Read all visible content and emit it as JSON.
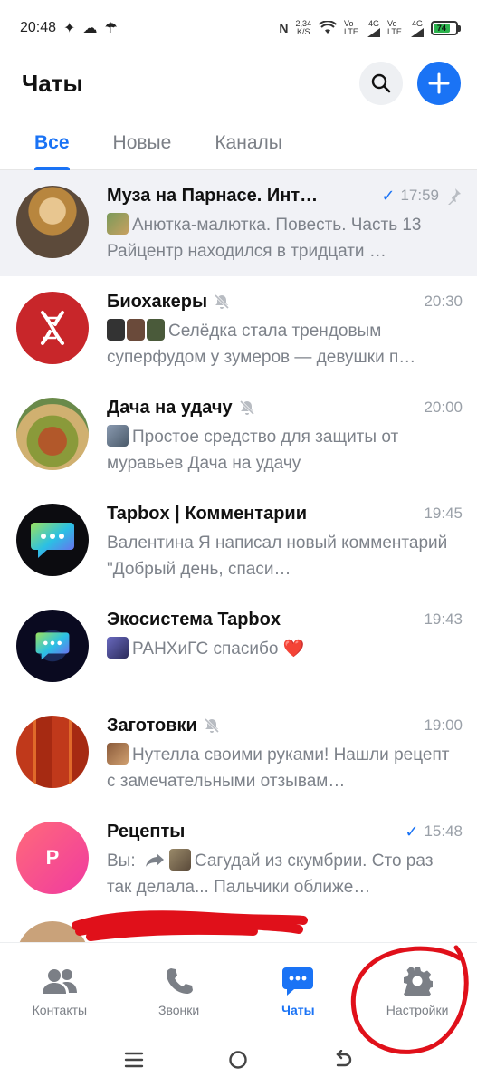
{
  "status_bar": {
    "time": "20:48",
    "net_speed_value": "2,34",
    "net_speed_unit": "K/S",
    "sim1": "Vo LTE",
    "sim1_net": "4G",
    "sim2": "Vo LTE",
    "sim2_net": "4G",
    "battery": "74"
  },
  "header": {
    "title": "Чаты",
    "search_icon": "search-icon",
    "add_icon": "plus-icon"
  },
  "tabs": [
    {
      "label": "Все",
      "active": true
    },
    {
      "label": "Новые",
      "active": false
    },
    {
      "label": "Каналы",
      "active": false
    }
  ],
  "chats": [
    {
      "name": "Муза на Парнасе. Инт…",
      "time": "17:59",
      "read": true,
      "pinned": true,
      "muted": false,
      "preview": "Анютка-малютка. Повесть. Часть 13 Райцентр находился в тридцати …",
      "prefix": ""
    },
    {
      "name": "Биохакеры",
      "time": "20:30",
      "read": false,
      "pinned": false,
      "muted": true,
      "preview": "Селёдка стала трендовым суперфудом у зумеров — девушки п…",
      "prefix": ""
    },
    {
      "name": "Дача на удачу",
      "time": "20:00",
      "read": false,
      "pinned": false,
      "muted": true,
      "preview": "Простое средство для защиты от муравьев Дача на удачу",
      "prefix": ""
    },
    {
      "name": "Tapbox | Комментарии",
      "time": "19:45",
      "read": false,
      "pinned": false,
      "muted": false,
      "preview": "Валентина Я написал новый комментарий \"Добрый день, спаси…",
      "prefix": ""
    },
    {
      "name": "Экосистема Tapbox",
      "time": "19:43",
      "read": false,
      "pinned": false,
      "muted": false,
      "preview": "РАНХиГС спасибо ❤️",
      "prefix": ""
    },
    {
      "name": "Заготовки",
      "time": "19:00",
      "read": false,
      "pinned": false,
      "muted": true,
      "preview": "Нутелла своими руками! Нашли рецепт с замечательными отзывам…",
      "prefix": ""
    },
    {
      "name": "Рецепты",
      "time": "15:48",
      "read": true,
      "pinned": false,
      "muted": false,
      "preview": "Сагудай из скумбрии. Сто раз так делала... Пальчики оближе…",
      "prefix": "Вы:",
      "avatar_letter": "Р"
    }
  ],
  "bottom_nav": [
    {
      "label": "Контакты",
      "icon": "contacts-icon",
      "active": false
    },
    {
      "label": "Звонки",
      "icon": "phone-icon",
      "active": false
    },
    {
      "label": "Чаты",
      "icon": "chat-bubble-icon",
      "active": true
    },
    {
      "label": "Настройки",
      "icon": "gear-icon",
      "active": false
    }
  ],
  "colors": {
    "accent": "#1a73f5",
    "annotation": "#e0101a"
  }
}
